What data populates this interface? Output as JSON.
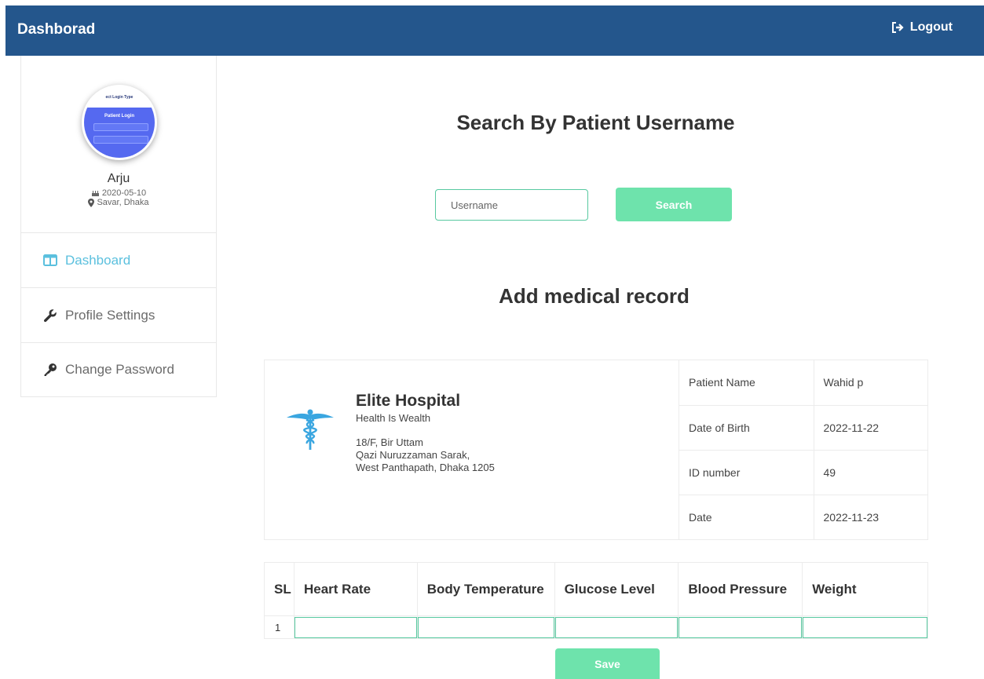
{
  "header": {
    "title": "Dashborad",
    "logout_label": "Logout"
  },
  "profile": {
    "name": "Arju",
    "dob": "2020-05-10",
    "location": "Savar, Dhaka",
    "avatar_title": "ect Login Type",
    "avatar_heading": "Patient Login"
  },
  "sidebar": {
    "items": [
      {
        "label": "Dashboard",
        "icon": "columns-icon",
        "active": true
      },
      {
        "label": "Profile Settings",
        "icon": "wrench-icon",
        "active": false
      },
      {
        "label": "Change Password",
        "icon": "key-icon",
        "active": false
      }
    ]
  },
  "search": {
    "heading": "Search By Patient Username",
    "placeholder": "Username",
    "button_label": "Search"
  },
  "record": {
    "heading": "Add medical record",
    "hospital": {
      "name": "Elite Hospital",
      "tagline": "Health Is Wealth",
      "address_line1": "18/F, Bir Uttam",
      "address_line2": "Qazi Nuruzzaman Sarak,",
      "address_line3": "West Panthapath, Dhaka 1205",
      "logo_icon": "caduceus-icon",
      "logo_color": "#3aa6e0"
    },
    "patient": [
      {
        "label": "Patient Name",
        "value": "Wahid p"
      },
      {
        "label": "Date of Birth",
        "value": "2022-11-22"
      },
      {
        "label": "ID number",
        "value": "49"
      },
      {
        "label": "Date",
        "value": "2022-11-23"
      }
    ],
    "columns": [
      "SL",
      "Heart Rate",
      "Body Temperature",
      "Glucose Level",
      "Blood Pressure",
      "Weight"
    ],
    "rows": [
      {
        "sl": "1"
      }
    ],
    "save_label": "Save"
  },
  "colors": {
    "header_bg": "#24568c",
    "accent_green": "#6ee3ac",
    "active_nav": "#5bc0de"
  }
}
